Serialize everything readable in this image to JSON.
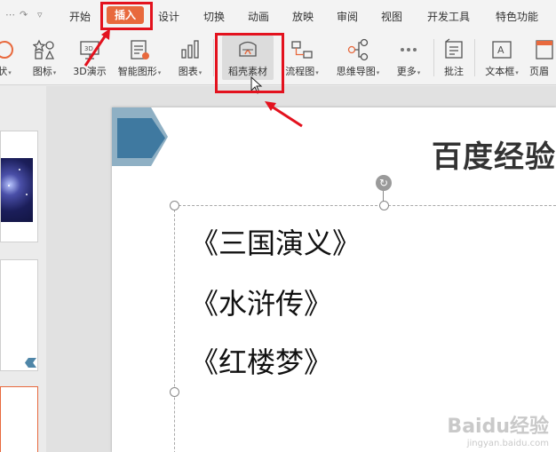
{
  "tabs": [
    {
      "label": "开始"
    },
    {
      "label": "插入"
    },
    {
      "label": "设计"
    },
    {
      "label": "切换"
    },
    {
      "label": "动画"
    },
    {
      "label": "放映"
    },
    {
      "label": "审阅"
    },
    {
      "label": "视图"
    },
    {
      "label": "开发工具"
    },
    {
      "label": "特色功能"
    }
  ],
  "ribbon": {
    "items": [
      {
        "label": "状",
        "icon": "shapes-icon"
      },
      {
        "label": "图标",
        "icon": "icons-icon"
      },
      {
        "label": "3D演示",
        "icon": "3d-presentation-icon"
      },
      {
        "label": "智能图形",
        "icon": "smartart-icon"
      },
      {
        "label": "图表",
        "icon": "chart-icon"
      },
      {
        "label": "稻壳素材",
        "icon": "docer-material-icon"
      },
      {
        "label": "流程图",
        "icon": "flowchart-icon"
      },
      {
        "label": "思维导图",
        "icon": "mindmap-icon"
      },
      {
        "label": "更多",
        "icon": "more-icon"
      },
      {
        "label": "批注",
        "icon": "comment-icon"
      },
      {
        "label": "文本框",
        "icon": "textbox-icon"
      },
      {
        "label": "页眉",
        "icon": "header-icon"
      }
    ]
  },
  "slide": {
    "title": "百度经验",
    "lines": [
      "《三国演义》",
      "《水浒传》",
      "《红楼梦》"
    ]
  },
  "watermark": {
    "brand": "Baidu经验",
    "url": "jingyan.baidu.com"
  },
  "colors": {
    "active_tab": "#e8693d",
    "annotation_red": "#e3121e",
    "slide_accent": "#3f79a0"
  }
}
